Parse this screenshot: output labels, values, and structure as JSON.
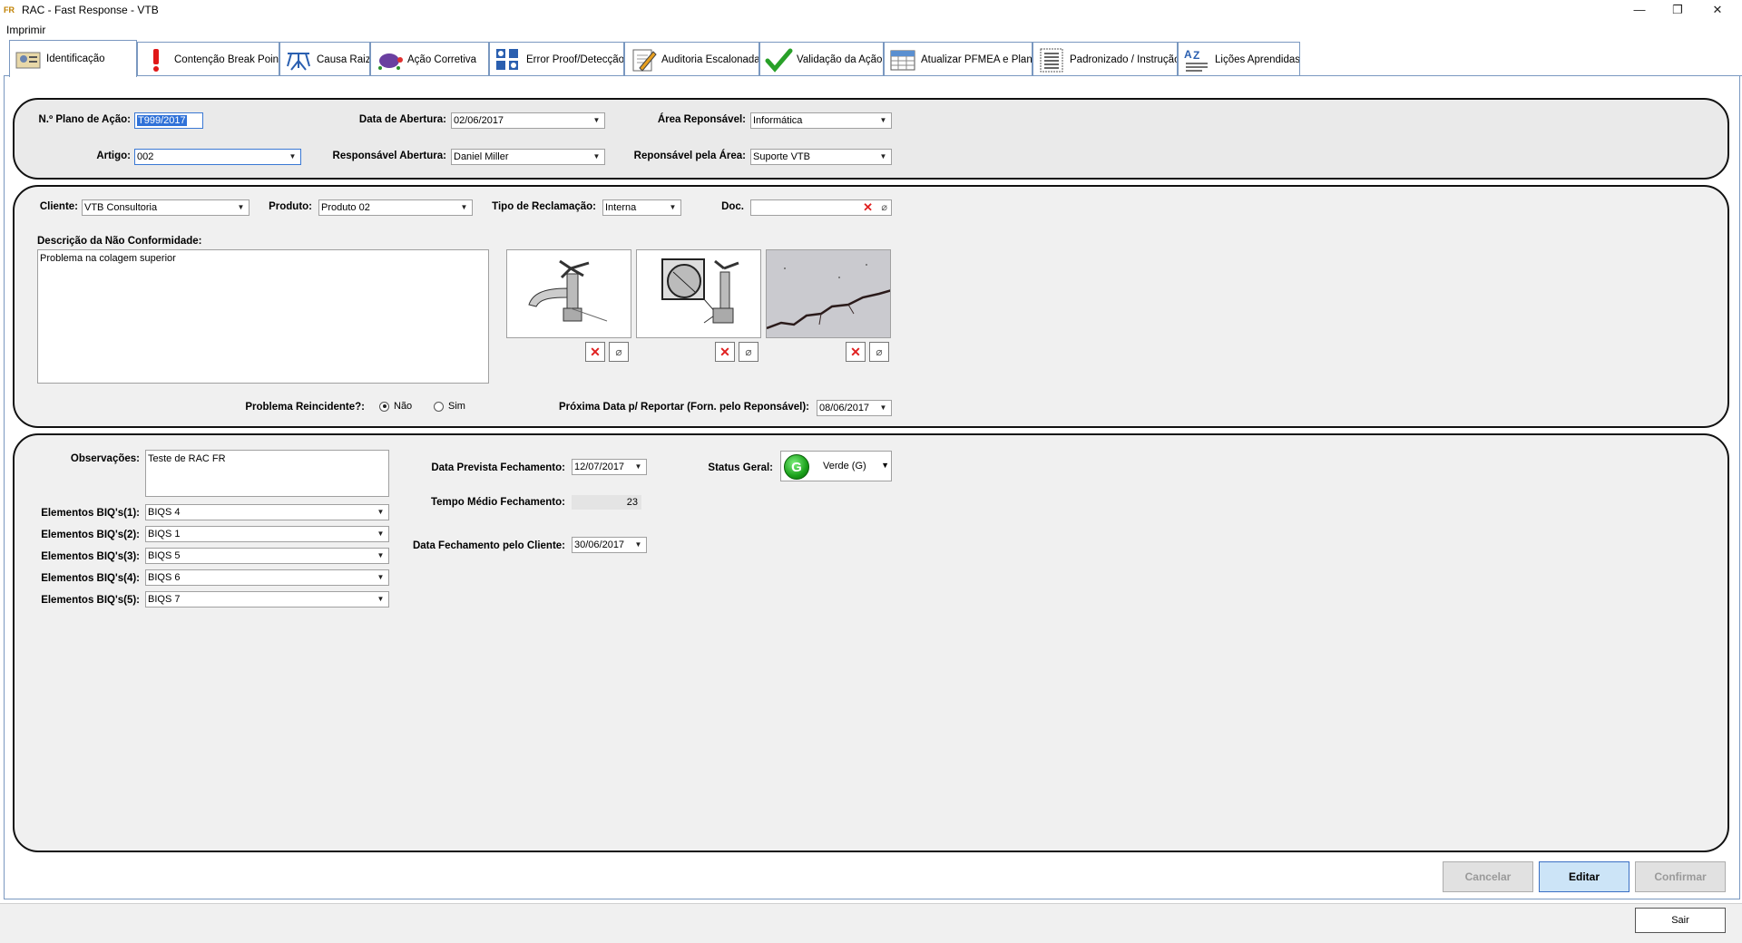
{
  "window": {
    "app_icon": "FR",
    "title": "RAC - Fast Response - VTB",
    "minimize": "—",
    "restore": "❐",
    "close": "✕"
  },
  "menu": {
    "print": "Imprimir"
  },
  "tabs": [
    {
      "label": "Identificação",
      "icon": "id-card-icon"
    },
    {
      "label": "Contenção Break Point",
      "icon": "exclamation-icon"
    },
    {
      "label": "Causa Raiz",
      "icon": "roots-icon"
    },
    {
      "label": "Ação Corretiva",
      "icon": "turtle-icon"
    },
    {
      "label": "Error Proof/Detecção",
      "icon": "dots-icon"
    },
    {
      "label": "Auditoria Escalonada",
      "icon": "pencil-paper-icon"
    },
    {
      "label": "Validação da Ação",
      "icon": "check-icon"
    },
    {
      "label": "Atualizar PFMEA e Plano",
      "icon": "table-icon"
    },
    {
      "label": "Padronizado / Instrução",
      "icon": "list-icon"
    },
    {
      "label": "Lições Aprendidas",
      "icon": "az-icon"
    }
  ],
  "header": {
    "plan_label": "N.º Plano de Ação:",
    "plan_value": "T999/2017",
    "opening_date_label": "Data de Abertura:",
    "opening_date_value": "02/06/2017",
    "area_label": "Área Reponsável:",
    "area_value": "Informática",
    "article_label": "Artigo:",
    "article_value": "002",
    "opening_resp_label": "Responsável Abertura:",
    "opening_resp_value": "Daniel Miller",
    "area_resp_label": "Reponsável pela Área:",
    "area_resp_value": "Suporte VTB"
  },
  "complaint": {
    "client_label": "Cliente:",
    "client_value": "VTB Consultoria",
    "product_label": "Produto:",
    "product_value": "Produto 02",
    "type_label": "Tipo de Reclamação:",
    "type_value": "Interna",
    "doc_label": "Doc.",
    "doc_value": "",
    "description_label": "Descrição da Não Conformidade:",
    "description_value": "Problema na colagem superior",
    "recurrent_label": "Problema Reincidente?:",
    "recurrent_no": "Não",
    "recurrent_yes": "Sim",
    "next_report_label": "Próxima Data p/ Reportar (Forn. pelo Reponsável):",
    "next_report_value": "08/06/2017"
  },
  "closing": {
    "obs_label": "Observações:",
    "obs_value": "Teste de RAC FR",
    "biq1_label": "Elementos BIQ's(1):",
    "biq1_value": "BIQS 4",
    "biq2_label": "Elementos BIQ's(2):",
    "biq2_value": "BIQS 1",
    "biq3_label": "Elementos BIQ's(3):",
    "biq3_value": "BIQS 5",
    "biq4_label": "Elementos BIQ's(4):",
    "biq4_value": "BIQS 6",
    "biq5_label": "Elementos BIQ's(5):",
    "biq5_value": "BIQS 7",
    "planned_close_label": "Data Prevista Fechamento:",
    "planned_close_value": "12/07/2017",
    "avg_time_label": "Tempo Médio Fechamento:",
    "avg_time_value": "23",
    "client_close_label": "Data Fechamento pelo Cliente:",
    "client_close_value": "30/06/2017",
    "status_label": "Status Geral:",
    "status_value": "Verde (G)",
    "status_badge": "G"
  },
  "buttons": {
    "cancel": "Cancelar",
    "edit": "Editar",
    "confirm": "Confirmar",
    "exit": "Sair"
  },
  "symbols": {
    "remove": "✕",
    "attach": "⌀",
    "dropdown": "▼"
  },
  "colors": {
    "tab_border": "#7a98c0",
    "primary_button": "#cce4f7",
    "status_green": "#1aa01a",
    "remove_red": "#e02020"
  }
}
